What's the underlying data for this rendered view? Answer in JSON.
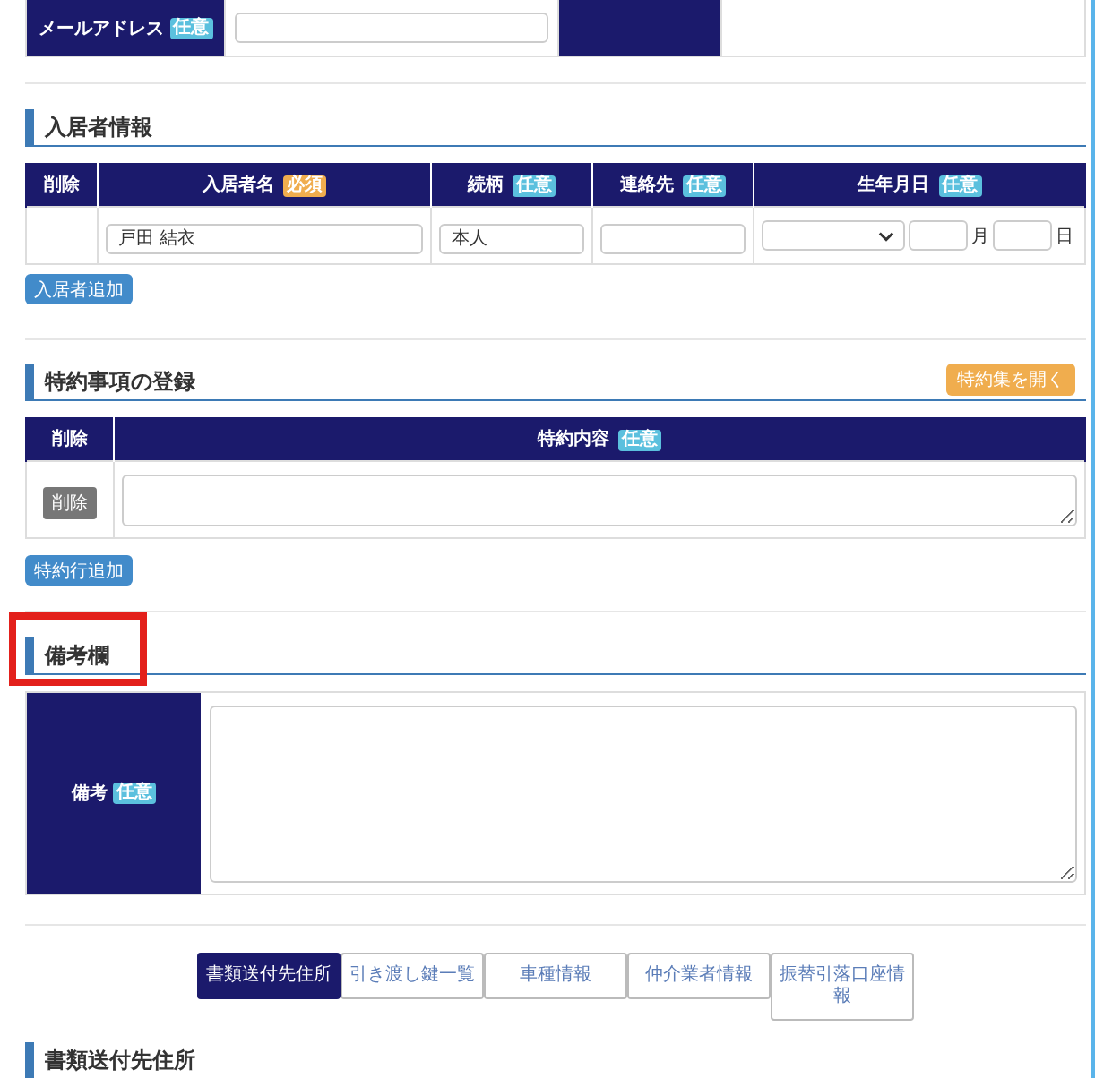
{
  "contact_row": {
    "label": "メールアドレス",
    "badge": {
      "kind": "optional",
      "text": "任意"
    }
  },
  "residents": {
    "title": "入居者情報",
    "columns": [
      {
        "label": "削除"
      },
      {
        "label": "入居者名",
        "badge": {
          "kind": "required",
          "text": "必須"
        }
      },
      {
        "label": "続柄",
        "badge": {
          "kind": "optional",
          "text": "任意"
        }
      },
      {
        "label": "連絡先",
        "badge": {
          "kind": "optional",
          "text": "任意"
        }
      },
      {
        "label": "生年月日",
        "badge": {
          "kind": "optional",
          "text": "任意"
        }
      }
    ],
    "rows": [
      {
        "name": "戸田 結衣",
        "relation": "本人",
        "month_unit": "月",
        "day_unit": "日"
      }
    ],
    "add_button": "入居者追加"
  },
  "special_terms": {
    "title": "特約事項の登録",
    "open_button": "特約集を開く",
    "columns": [
      {
        "label": "削除"
      },
      {
        "label": "特約内容",
        "badge": {
          "kind": "optional",
          "text": "任意"
        }
      }
    ],
    "rows": [
      {
        "delete_button": "削除"
      }
    ],
    "add_button": "特約行追加"
  },
  "remarks": {
    "title": "備考欄",
    "highlighted": true,
    "label": "備考",
    "badge": {
      "kind": "optional",
      "text": "任意"
    }
  },
  "tabs": [
    {
      "label": "書類送付先住所",
      "selected": true
    },
    {
      "label": "引き渡し鍵一覧",
      "selected": false
    },
    {
      "label": "車種情報",
      "selected": false
    },
    {
      "label": "仲介業者情報",
      "selected": false
    },
    {
      "label": "振替引落口座情報",
      "selected": false
    }
  ],
  "next_section": {
    "title": "書類送付先住所"
  }
}
